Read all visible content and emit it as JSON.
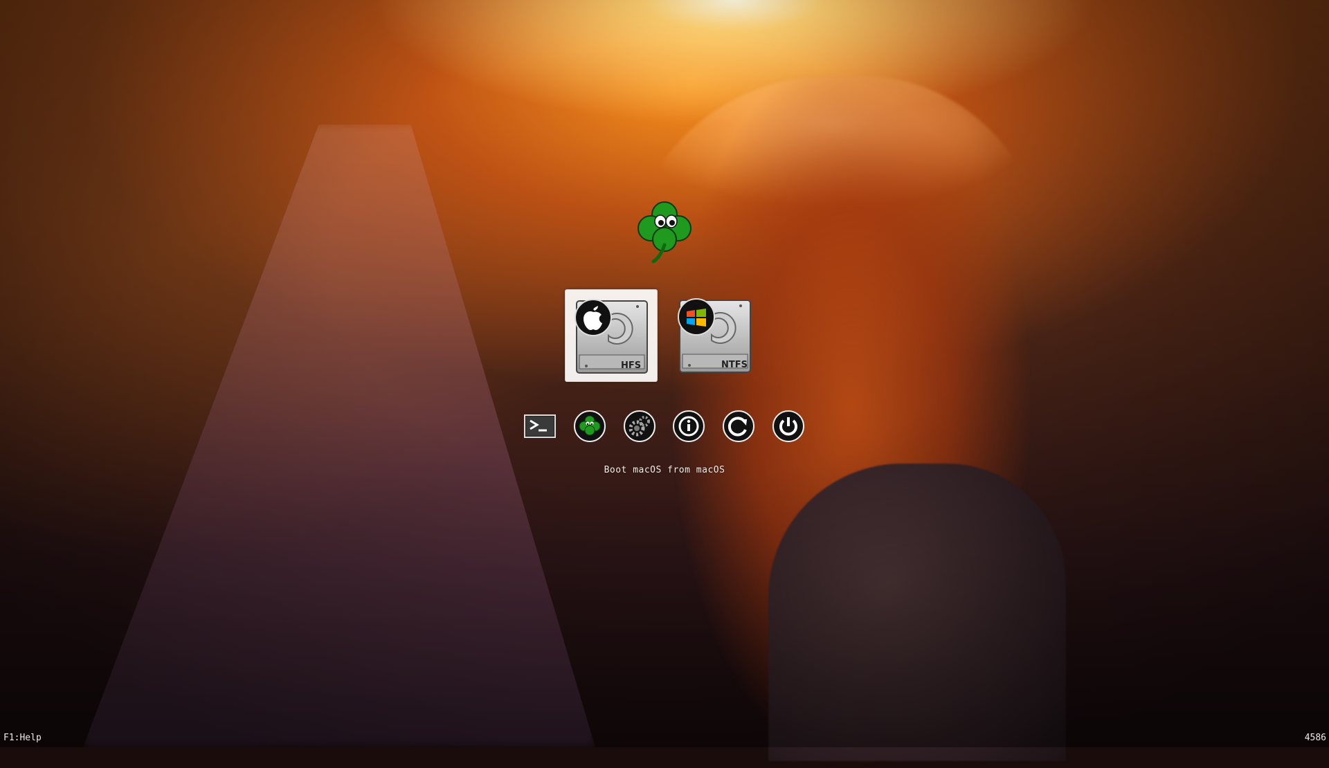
{
  "background": {
    "description_icon": "wallpaper-image"
  },
  "logo": {
    "icon": "clover-logo-icon"
  },
  "volumes": [
    {
      "fs_label": "HFS",
      "os_icon": "apple-icon",
      "selected": true
    },
    {
      "fs_label": "NTFS",
      "os_icon": "windows-icon",
      "selected": false
    }
  ],
  "tools": [
    {
      "icon": "shell-icon"
    },
    {
      "icon": "clover-options-icon"
    },
    {
      "icon": "settings-gear-icon"
    },
    {
      "icon": "about-info-icon"
    },
    {
      "icon": "reset-icon"
    },
    {
      "icon": "power-off-icon"
    }
  ],
  "status": {
    "text": "Boot macOS from macOS"
  },
  "footer": {
    "help": "F1:Help",
    "revision": "4586"
  },
  "colors": {
    "accent_green": "#1f8f1f",
    "text": "#f4eee8"
  }
}
